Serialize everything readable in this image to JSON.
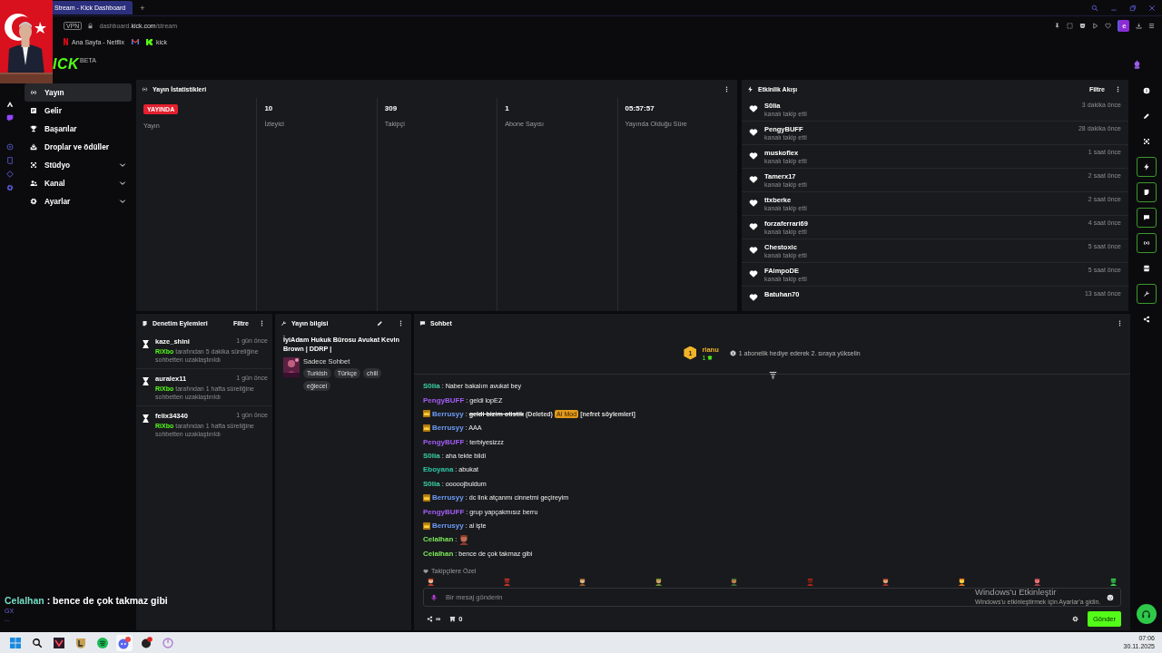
{
  "browser": {
    "tab_title": "Stream - Kick Dashboard",
    "new_tab": "+",
    "vpn": "VPN",
    "url_prefix": "dashboard.",
    "url_domain": "kick.com",
    "url_path": "/stream",
    "profile": "e",
    "bookmarks": [
      {
        "kind": "netflix",
        "label": "Ana Sayfa - Netflix"
      },
      {
        "kind": "gmail"
      },
      {
        "kind": "kick",
        "label": "kick"
      }
    ]
  },
  "logo": {
    "text": "ICK",
    "badge": "BETA"
  },
  "sidebar": {
    "items": [
      {
        "label": "Yayın",
        "kind": "link",
        "selected": true
      },
      {
        "label": "Gelir",
        "kind": "link",
        "selected": false
      },
      {
        "label": "Başarılar",
        "kind": "link",
        "selected": false
      },
      {
        "label": "Droplar ve ödüller",
        "kind": "link",
        "selected": false
      },
      {
        "label": "Stüdyo",
        "kind": "group",
        "selected": false,
        "expanded": false
      },
      {
        "label": "Kanal",
        "kind": "group",
        "selected": false,
        "expanded": false
      },
      {
        "label": "Ayarlar",
        "kind": "group",
        "selected": false,
        "expanded": false
      }
    ]
  },
  "stats": {
    "title": "Yayın İstatistikleri",
    "cells": [
      {
        "kind": "badge",
        "value": "YAYINDA",
        "label": "Yayın"
      },
      {
        "kind": "number",
        "value": "10",
        "label": "İzleyici"
      },
      {
        "kind": "number",
        "value": "309",
        "label": "Takipçi"
      },
      {
        "kind": "number",
        "value": "1",
        "label": "Abone Sayısı"
      },
      {
        "kind": "number",
        "value": "05:57:57",
        "label": "Yayında Olduğu Süre"
      }
    ]
  },
  "activity": {
    "title": "Etkinlik Akışı",
    "filter": "Filtre",
    "events": [
      {
        "user": "S0lia",
        "action": "kanalı takip etti",
        "time": "3 dakika önce"
      },
      {
        "user": "PengyBUFF",
        "action": "kanalı takip etti",
        "time": "28 dakika önce"
      },
      {
        "user": "muskoflex",
        "action": "kanalı takip etti",
        "time": "1 saat önce"
      },
      {
        "user": "Tamerx17",
        "action": "kanalı takip etti",
        "time": "2 saat önce"
      },
      {
        "user": "ttxberke",
        "action": "kanalı takip etti",
        "time": "2 saat önce"
      },
      {
        "user": "forzaferrari69",
        "action": "kanalı takip etti",
        "time": "4 saat önce"
      },
      {
        "user": "Chestoxic",
        "action": "kanalı takip etti",
        "time": "5 saat önce"
      },
      {
        "user": "FAimpoDE",
        "action": "kanalı takip etti",
        "time": "5 saat önce"
      },
      {
        "user": "Batuhan70",
        "time": "13 saat önce"
      }
    ]
  },
  "tools": [
    {
      "kind": "info",
      "active": false
    },
    {
      "kind": "edit",
      "active": false
    },
    {
      "kind": "frame",
      "active": false
    },
    {
      "kind": "bolt",
      "active": true
    },
    {
      "kind": "note",
      "active": true
    },
    {
      "kind": "chat",
      "active": true
    },
    {
      "kind": "broadcast",
      "active": true
    },
    {
      "kind": "layout",
      "active": false
    },
    {
      "kind": "wrench",
      "active": true
    },
    {
      "kind": "share",
      "active": false
    }
  ],
  "moderation": {
    "title": "Denetim Eylemleri",
    "filter": "Filtre",
    "actions": [
      {
        "user": "kaze_shini",
        "time": "1 gün önce",
        "moderator": "RiXbo",
        "text": "tarafından 5 dakika süreliğine sohbetten uzaklaştırıldı"
      },
      {
        "user": "auralex11",
        "time": "1 gün önce",
        "moderator": "RiXbo",
        "text": "tarafından 1 hafta süreliğine sohbetten uzaklaştırıldı"
      },
      {
        "user": "felix34340",
        "time": "1 gün önce",
        "moderator": "RiXbo",
        "text": "tarafından 1 hafta süreliğine sohbetten uzaklaştırıldı"
      }
    ]
  },
  "stream_info": {
    "title": "Yayın bilgisi",
    "stream_title": "İyiAdam Hukuk Bürosu Avukat Kevin Brown | DDRP |",
    "category": "Sadece Sohbet",
    "tags": [
      "Turkish",
      "Türkçe",
      "chill",
      "eğlecel"
    ]
  },
  "chat": {
    "title": "Sohbet",
    "leader": {
      "rank": "1",
      "user": "rianu",
      "gifts": "1",
      "hint": "1 abonelik hediye ederek 2. sıraya yükselin"
    },
    "messages": [
      {
        "kind": "text",
        "user": "S0lia",
        "color": "#3ad0a4",
        "badge": false,
        "text": ": Naber bakalım avukat bey"
      },
      {
        "kind": "text",
        "user": "PengyBUFF",
        "color": "#a35cf5",
        "badge": false,
        "text": ": geldi lopEZ"
      },
      {
        "kind": "deleted",
        "user": "Berrusyy",
        "color": "#6d9cf7",
        "badge": true,
        "separator": ":",
        "text": "geldi bizim otistik",
        "status": "(Deleted)",
        "label": "AI Mod",
        "reason": "[nefret söylemleri]"
      },
      {
        "kind": "text",
        "user": "Berrusyy",
        "color": "#6d9cf7",
        "badge": true,
        "text": ": AAA"
      },
      {
        "kind": "text",
        "user": "PengyBUFF",
        "color": "#a35cf5",
        "badge": false,
        "text": ": terbiyesizzz"
      },
      {
        "kind": "text",
        "user": "S0lia",
        "color": "#3ad0a4",
        "badge": false,
        "text": ": aha tekte bildi"
      },
      {
        "kind": "text",
        "user": "Eboyana",
        "color": "#2fc6a8",
        "badge": false,
        "text": ": abukat"
      },
      {
        "kind": "text",
        "user": "S0lia",
        "color": "#3ad0a4",
        "badge": false,
        "text": ": ooooojbuldum"
      },
      {
        "kind": "text",
        "user": "Berrusyy",
        "color": "#6d9cf7",
        "badge": true,
        "text": ": dc link atçanmı cinnetmi geçireyim"
      },
      {
        "kind": "text",
        "user": "PengyBUFF",
        "color": "#a35cf5",
        "badge": false,
        "text": ": grup yapçakmısız berru"
      },
      {
        "kind": "text",
        "user": "Berrusyy",
        "color": "#6d9cf7",
        "badge": true,
        "text": ": al işte"
      },
      {
        "kind": "emote",
        "user": "Celalhan",
        "color": "#7be85a",
        "badge": false,
        "text": ":"
      },
      {
        "kind": "text",
        "user": "Celalhan",
        "color": "#7be85a",
        "badge": false,
        "text": ": bence de çok takmaz gibi"
      }
    ],
    "emote_section": "Takipçilere Özel",
    "placeholder": "Bir mesaj gönderin",
    "share_count": "∞",
    "store_count": "0",
    "send": "Gönder"
  },
  "overlay": {
    "user": "Celalhan",
    "text": ": bence de çok takmaz gibi",
    "tag": "GX",
    "more": "..."
  },
  "activation": {
    "title": "Windows'u Etkinleştir",
    "text": "Windows'u etkinleştirmek için Ayarlar'a gidin."
  },
  "taskbar": {
    "time": "07:06",
    "date": "30.11.2025"
  }
}
